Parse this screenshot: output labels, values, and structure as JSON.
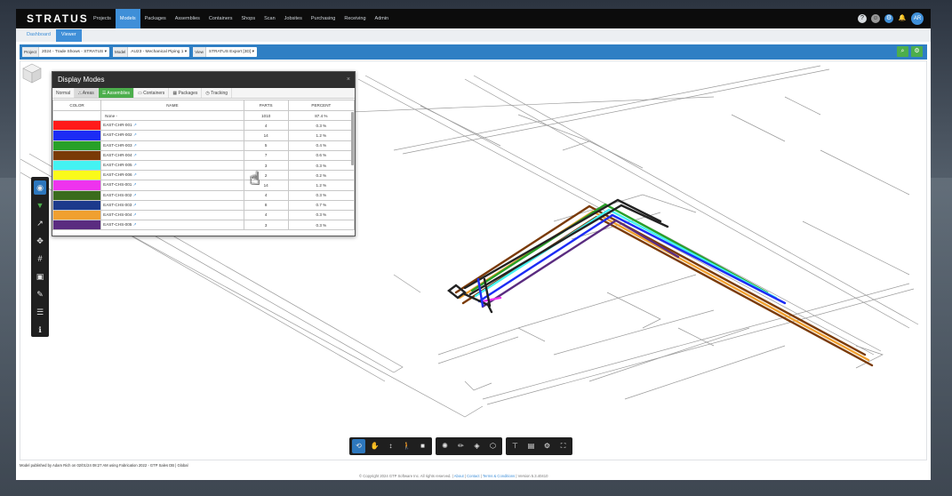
{
  "app": {
    "logo": "STRATUS",
    "nav": [
      "Projects",
      "Models",
      "Packages",
      "Assemblies",
      "Containers",
      "Shops",
      "Scan",
      "Jobsites",
      "Purchasing",
      "Receiving",
      "Admin"
    ],
    "active_nav": "Models",
    "user_initials": "AR"
  },
  "subtabs": [
    "Dashboard",
    "Viewer"
  ],
  "filters": {
    "project_label": "Project",
    "project_value": "2024 - Trade Shows - STRATUS ▾",
    "model_label": "Model",
    "model_value": "AU23 - Mechanical Piping 1 ▾",
    "view_label": "View",
    "view_value": "STRATUS Export [3D] ▾"
  },
  "display_modes": {
    "title": "Display Modes",
    "close": "×",
    "tabs": [
      "Normal",
      "Areas",
      "Assemblies",
      "Containers",
      "Packages",
      "Tracking"
    ],
    "active_tab": "Assemblies",
    "columns": [
      "COLOR",
      "NAME",
      "PARTS",
      "PERCENT"
    ],
    "rows": [
      {
        "color": "",
        "name": "None -",
        "parts": "1010",
        "percent": "87.4 %"
      },
      {
        "color": "#ff1a1a",
        "name": "EAST-CHR-001",
        "parts": "4",
        "percent": "0.3 %"
      },
      {
        "color": "#1c2cf5",
        "name": "EAST-CHR-002",
        "parts": "14",
        "percent": "1.2 %"
      },
      {
        "color": "#28a028",
        "name": "EAST-CHR-003",
        "parts": "5",
        "percent": "0.4 %"
      },
      {
        "color": "#7a3a06",
        "name": "EAST-CHR-004",
        "parts": "7",
        "percent": "0.6 %"
      },
      {
        "color": "#44f2f2",
        "name": "EAST-CHR-005",
        "parts": "3",
        "percent": "0.3 %"
      },
      {
        "color": "#fafa1a",
        "name": "EAST-CHR-006",
        "parts": "2",
        "percent": "0.2 %"
      },
      {
        "color": "#ee33ee",
        "name": "EAST-CHS-001",
        "parts": "14",
        "percent": "1.2 %"
      },
      {
        "color": "#3a6c1c",
        "name": "EAST-CHS-002",
        "parts": "4",
        "percent": "0.3 %"
      },
      {
        "color": "#1c3a8c",
        "name": "EAST-CHS-003",
        "parts": "8",
        "percent": "0.7 %"
      },
      {
        "color": "#f0a030",
        "name": "EAST-CHS-004",
        "parts": "4",
        "percent": "0.3 %"
      },
      {
        "color": "#5a2c80",
        "name": "EAST-CHS-005",
        "parts": "3",
        "percent": "0.3 %"
      }
    ]
  },
  "status_text": "Model published by Adam Rich on 02/01/24 08:27 AM using Fabrication 2022 - GTP Sales DB | Global",
  "copyright": {
    "prefix": "© Copyright 2024 GTP Software Inc. All rights reserved.",
    "about": "About",
    "contact": "Contact",
    "terms": "Terms & Conditions",
    "version": "Version 5.3.40410"
  }
}
